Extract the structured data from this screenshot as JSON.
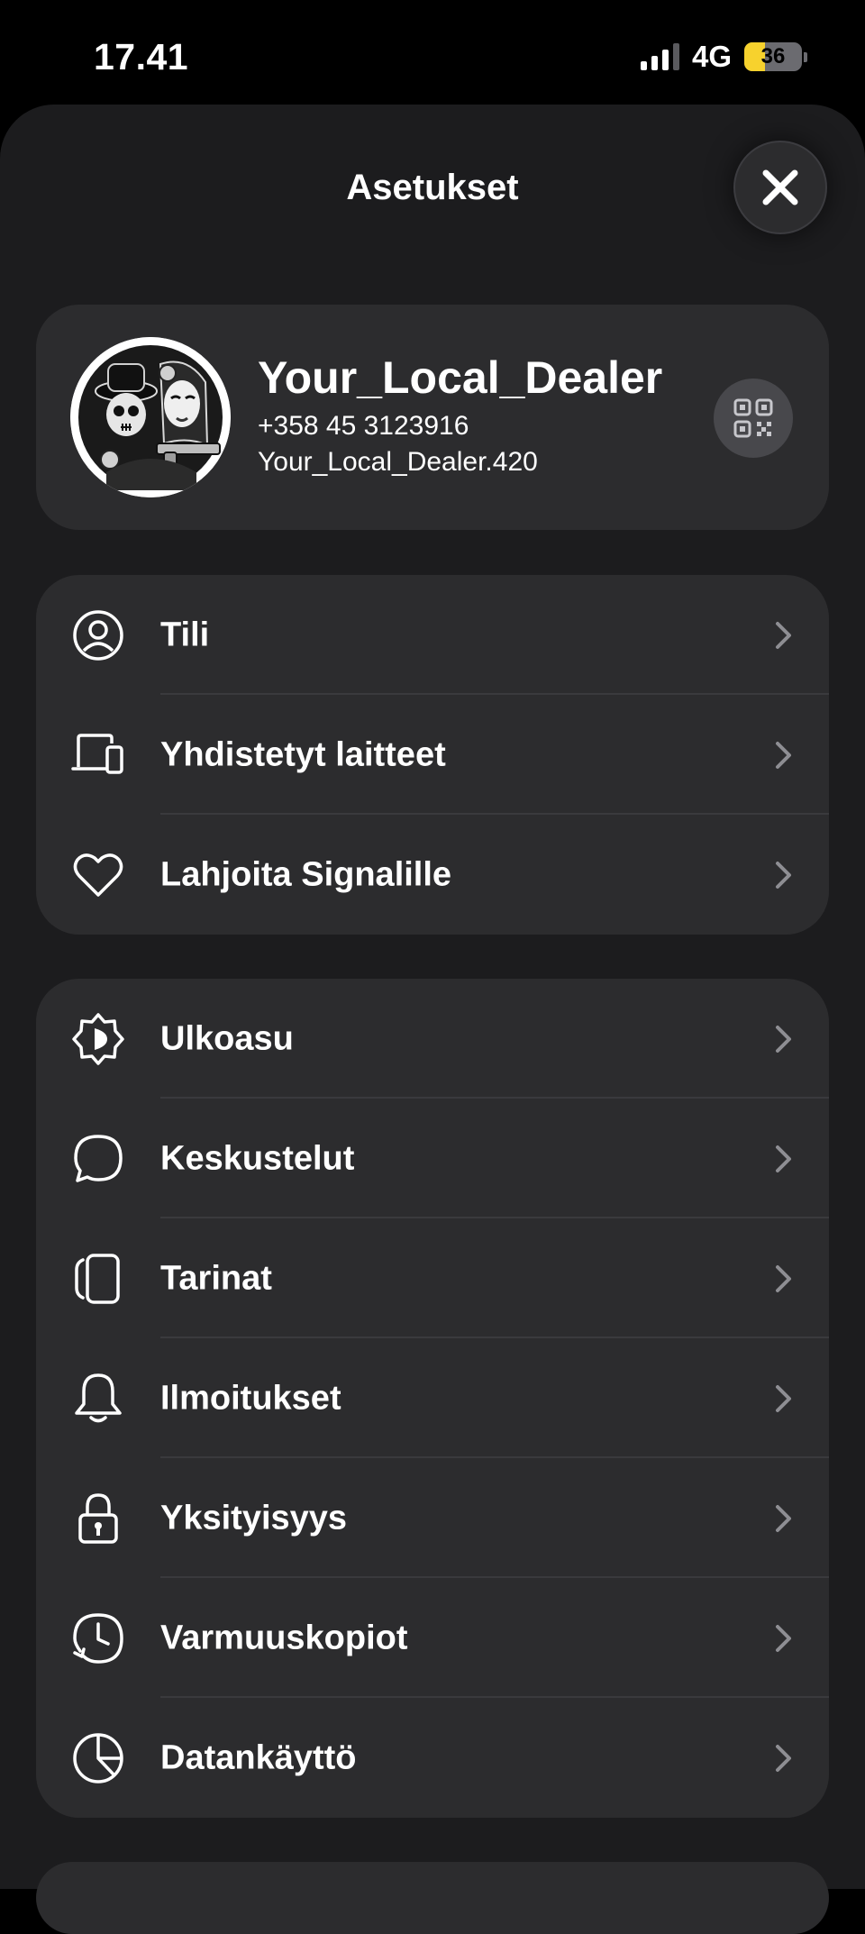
{
  "status_bar": {
    "time": "17.41",
    "network": "4G",
    "battery_level": "36",
    "battery_fraction": 0.36,
    "battery_color": "#f7d22d",
    "signal_bars_active": 3
  },
  "header": {
    "title": "Asetukset",
    "close_icon": "close-icon"
  },
  "profile": {
    "name": "Your_Local_Dealer",
    "phone": "+358 45 3123916",
    "username": "Your_Local_Dealer.420",
    "avatar_icon": "avatar-illustration",
    "qr_icon": "qr-code-icon"
  },
  "groups": [
    {
      "items": [
        {
          "label": "Tili",
          "icon": "account-icon"
        },
        {
          "label": "Yhdistetyt laitteet",
          "icon": "linked-devices-icon"
        },
        {
          "label": "Lahjoita Signalille",
          "icon": "heart-icon"
        }
      ]
    },
    {
      "items": [
        {
          "label": "Ulkoasu",
          "icon": "appearance-icon"
        },
        {
          "label": "Keskustelut",
          "icon": "chat-bubble-icon"
        },
        {
          "label": "Tarinat",
          "icon": "stories-icon"
        },
        {
          "label": "Ilmoitukset",
          "icon": "bell-icon"
        },
        {
          "label": "Yksityisyys",
          "icon": "lock-icon"
        },
        {
          "label": "Varmuuskopiot",
          "icon": "backup-clock-icon"
        },
        {
          "label": "Datankäyttö",
          "icon": "pie-chart-icon"
        }
      ]
    }
  ],
  "colors": {
    "background": "#000000",
    "sheet": "#1c1c1e",
    "card": "#2c2c2e",
    "chevron": "#8e8e93"
  }
}
